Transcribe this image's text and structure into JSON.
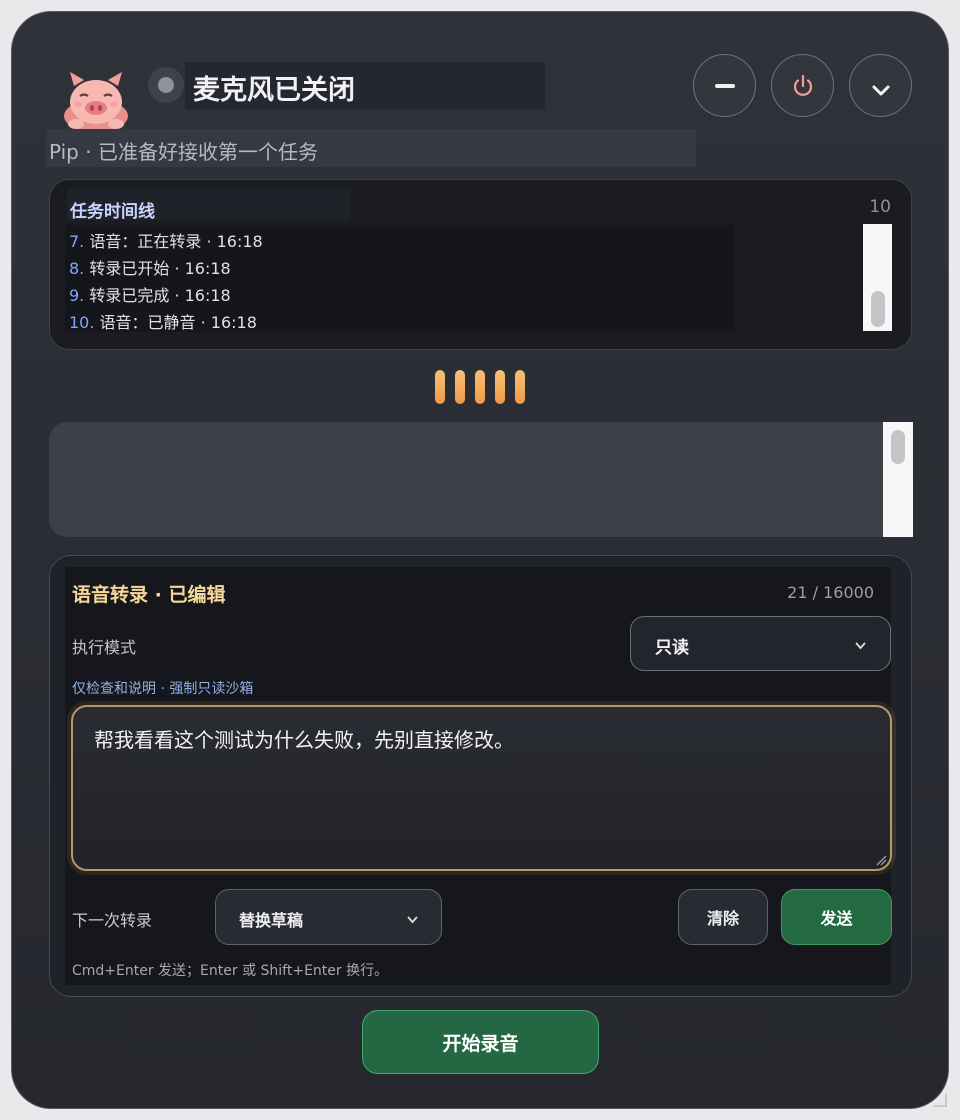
{
  "header": {
    "mascot_icon": "pig-mascot-icon",
    "status_dot_color": "#8f929c",
    "title": "麦克风已关闭",
    "subtitle": "Pip · 已准备好接收第一个任务",
    "buttons": [
      {
        "name": "minimize",
        "icon": "minus-icon"
      },
      {
        "name": "power",
        "icon": "power-icon",
        "color": "#f0a096"
      },
      {
        "name": "collapse",
        "icon": "chevron-down-icon"
      }
    ]
  },
  "timeline": {
    "title": "任务时间线",
    "count": "10",
    "items": [
      {
        "num": "7.",
        "text": " 语音：正在转录 · 16:18"
      },
      {
        "num": "8.",
        "text": " 转录已开始 · 16:18"
      },
      {
        "num": "9.",
        "text": " 转录已完成 · 16:18"
      },
      {
        "num": "10.",
        "text": " 语音：已静音 · 16:18"
      }
    ]
  },
  "waveform": {
    "bars": 5,
    "color": "#f3a958"
  },
  "editor": {
    "title": "语音转录 · 已编辑",
    "char_count": "21 / 16000",
    "mode_label": "执行模式",
    "mode_value": "只读",
    "mode_help": "仅检查和说明 · 强制只读沙箱",
    "text": "帮我看看这个测试为什么失败，先别直接修改。",
    "next_label": "下一次转录",
    "next_value": "替换草稿",
    "clear_label": "清除",
    "send_label": "发送",
    "hint": "Cmd+Enter 发送；Enter 或 Shift+Enter 换行。"
  },
  "record_button": {
    "label": "开始录音",
    "color": "#236842"
  },
  "colors": {
    "accent_gold": "#f7d89a",
    "link_blue": "#7fa6ff",
    "send_green": "#236a43"
  }
}
